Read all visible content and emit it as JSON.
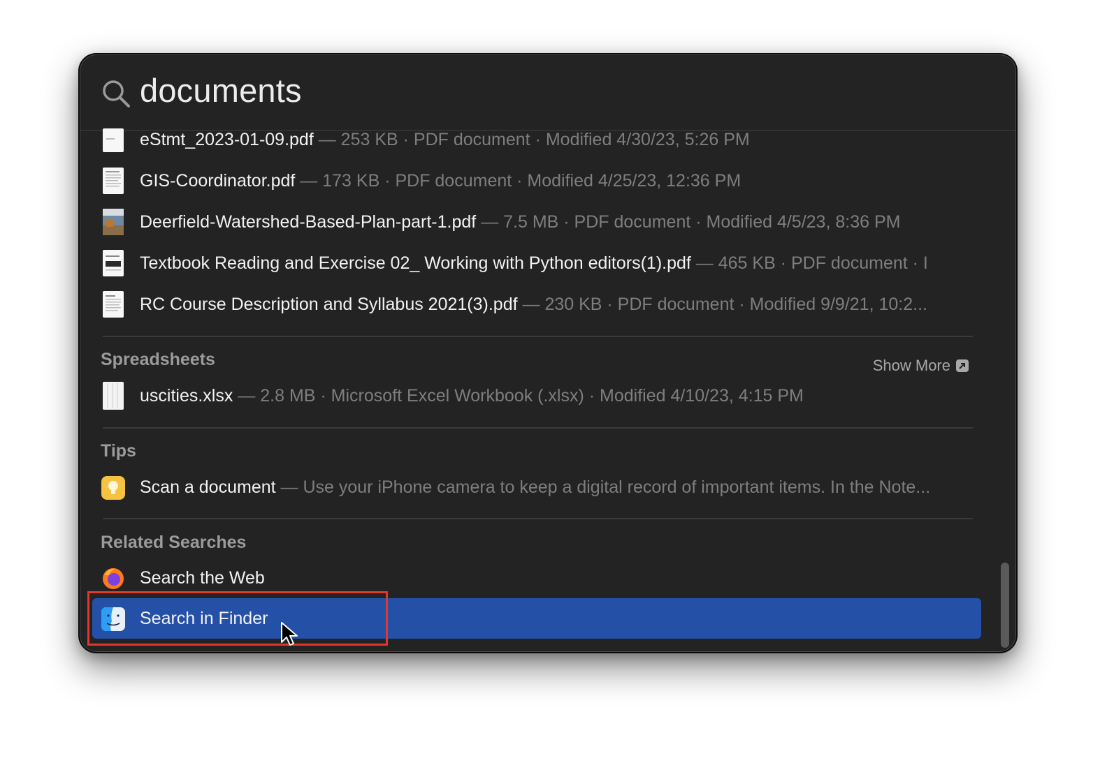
{
  "search": {
    "query": "documents"
  },
  "documents": [
    {
      "name": "eStmt_2023-01-09.pdf",
      "meta": " — 253 KB · PDF document · Modified 4/30/23, 5:26 PM"
    },
    {
      "name": "GIS-Coordinator.pdf",
      "meta": " — 173 KB · PDF document · Modified 4/25/23, 12:36 PM"
    },
    {
      "name": "Deerfield-Watershed-Based-Plan-part-1.pdf",
      "meta": " — 7.5 MB · PDF document · Modified 4/5/23, 8:36 PM"
    },
    {
      "name": "Textbook Reading and Exercise 02_ Working with Python editors(1).pdf",
      "meta": " — 465 KB · PDF document · I"
    },
    {
      "name": "RC Course Description and Syllabus 2021(3).pdf",
      "meta": " — 230 KB · PDF document · Modified 9/9/21, 10:2..."
    }
  ],
  "spreadsheets": {
    "title": "Spreadsheets",
    "show_more": "Show More",
    "items": [
      {
        "name": "uscities.xlsx",
        "meta": " — 2.8 MB · Microsoft Excel Workbook (.xlsx) · Modified 4/10/23, 4:15 PM"
      }
    ]
  },
  "tips": {
    "title": "Tips",
    "items": [
      {
        "name": "Scan a document",
        "meta": " — Use your iPhone camera to keep a digital record of important items. In the Note..."
      }
    ]
  },
  "related": {
    "title": "Related Searches",
    "items": [
      {
        "name": "Search the Web",
        "icon": "firefox-icon"
      },
      {
        "name": "Search in Finder",
        "icon": "finder-icon",
        "selected": true
      }
    ]
  },
  "colors": {
    "selection": "#2450a8",
    "highlight_box": "#e0392b"
  }
}
